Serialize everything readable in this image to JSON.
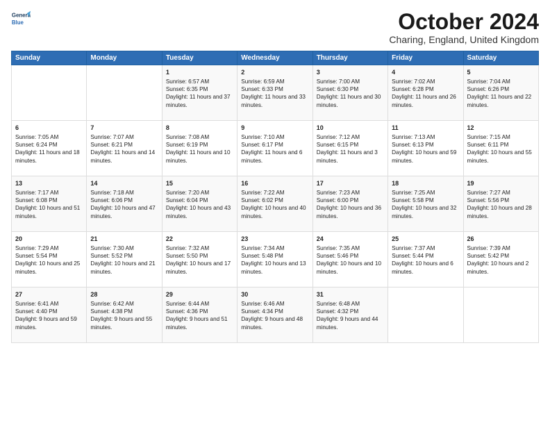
{
  "logo": {
    "line1": "General",
    "line2": "Blue"
  },
  "title": "October 2024",
  "subtitle": "Charing, England, United Kingdom",
  "days_header": [
    "Sunday",
    "Monday",
    "Tuesday",
    "Wednesday",
    "Thursday",
    "Friday",
    "Saturday"
  ],
  "weeks": [
    [
      {
        "day": "",
        "sunrise": "",
        "sunset": "",
        "daylight": ""
      },
      {
        "day": "",
        "sunrise": "",
        "sunset": "",
        "daylight": ""
      },
      {
        "day": "1",
        "sunrise": "Sunrise: 6:57 AM",
        "sunset": "Sunset: 6:35 PM",
        "daylight": "Daylight: 11 hours and 37 minutes."
      },
      {
        "day": "2",
        "sunrise": "Sunrise: 6:59 AM",
        "sunset": "Sunset: 6:33 PM",
        "daylight": "Daylight: 11 hours and 33 minutes."
      },
      {
        "day": "3",
        "sunrise": "Sunrise: 7:00 AM",
        "sunset": "Sunset: 6:30 PM",
        "daylight": "Daylight: 11 hours and 30 minutes."
      },
      {
        "day": "4",
        "sunrise": "Sunrise: 7:02 AM",
        "sunset": "Sunset: 6:28 PM",
        "daylight": "Daylight: 11 hours and 26 minutes."
      },
      {
        "day": "5",
        "sunrise": "Sunrise: 7:04 AM",
        "sunset": "Sunset: 6:26 PM",
        "daylight": "Daylight: 11 hours and 22 minutes."
      }
    ],
    [
      {
        "day": "6",
        "sunrise": "Sunrise: 7:05 AM",
        "sunset": "Sunset: 6:24 PM",
        "daylight": "Daylight: 11 hours and 18 minutes."
      },
      {
        "day": "7",
        "sunrise": "Sunrise: 7:07 AM",
        "sunset": "Sunset: 6:21 PM",
        "daylight": "Daylight: 11 hours and 14 minutes."
      },
      {
        "day": "8",
        "sunrise": "Sunrise: 7:08 AM",
        "sunset": "Sunset: 6:19 PM",
        "daylight": "Daylight: 11 hours and 10 minutes."
      },
      {
        "day": "9",
        "sunrise": "Sunrise: 7:10 AM",
        "sunset": "Sunset: 6:17 PM",
        "daylight": "Daylight: 11 hours and 6 minutes."
      },
      {
        "day": "10",
        "sunrise": "Sunrise: 7:12 AM",
        "sunset": "Sunset: 6:15 PM",
        "daylight": "Daylight: 11 hours and 3 minutes."
      },
      {
        "day": "11",
        "sunrise": "Sunrise: 7:13 AM",
        "sunset": "Sunset: 6:13 PM",
        "daylight": "Daylight: 10 hours and 59 minutes."
      },
      {
        "day": "12",
        "sunrise": "Sunrise: 7:15 AM",
        "sunset": "Sunset: 6:11 PM",
        "daylight": "Daylight: 10 hours and 55 minutes."
      }
    ],
    [
      {
        "day": "13",
        "sunrise": "Sunrise: 7:17 AM",
        "sunset": "Sunset: 6:08 PM",
        "daylight": "Daylight: 10 hours and 51 minutes."
      },
      {
        "day": "14",
        "sunrise": "Sunrise: 7:18 AM",
        "sunset": "Sunset: 6:06 PM",
        "daylight": "Daylight: 10 hours and 47 minutes."
      },
      {
        "day": "15",
        "sunrise": "Sunrise: 7:20 AM",
        "sunset": "Sunset: 6:04 PM",
        "daylight": "Daylight: 10 hours and 43 minutes."
      },
      {
        "day": "16",
        "sunrise": "Sunrise: 7:22 AM",
        "sunset": "Sunset: 6:02 PM",
        "daylight": "Daylight: 10 hours and 40 minutes."
      },
      {
        "day": "17",
        "sunrise": "Sunrise: 7:23 AM",
        "sunset": "Sunset: 6:00 PM",
        "daylight": "Daylight: 10 hours and 36 minutes."
      },
      {
        "day": "18",
        "sunrise": "Sunrise: 7:25 AM",
        "sunset": "Sunset: 5:58 PM",
        "daylight": "Daylight: 10 hours and 32 minutes."
      },
      {
        "day": "19",
        "sunrise": "Sunrise: 7:27 AM",
        "sunset": "Sunset: 5:56 PM",
        "daylight": "Daylight: 10 hours and 28 minutes."
      }
    ],
    [
      {
        "day": "20",
        "sunrise": "Sunrise: 7:29 AM",
        "sunset": "Sunset: 5:54 PM",
        "daylight": "Daylight: 10 hours and 25 minutes."
      },
      {
        "day": "21",
        "sunrise": "Sunrise: 7:30 AM",
        "sunset": "Sunset: 5:52 PM",
        "daylight": "Daylight: 10 hours and 21 minutes."
      },
      {
        "day": "22",
        "sunrise": "Sunrise: 7:32 AM",
        "sunset": "Sunset: 5:50 PM",
        "daylight": "Daylight: 10 hours and 17 minutes."
      },
      {
        "day": "23",
        "sunrise": "Sunrise: 7:34 AM",
        "sunset": "Sunset: 5:48 PM",
        "daylight": "Daylight: 10 hours and 13 minutes."
      },
      {
        "day": "24",
        "sunrise": "Sunrise: 7:35 AM",
        "sunset": "Sunset: 5:46 PM",
        "daylight": "Daylight: 10 hours and 10 minutes."
      },
      {
        "day": "25",
        "sunrise": "Sunrise: 7:37 AM",
        "sunset": "Sunset: 5:44 PM",
        "daylight": "Daylight: 10 hours and 6 minutes."
      },
      {
        "day": "26",
        "sunrise": "Sunrise: 7:39 AM",
        "sunset": "Sunset: 5:42 PM",
        "daylight": "Daylight: 10 hours and 2 minutes."
      }
    ],
    [
      {
        "day": "27",
        "sunrise": "Sunrise: 6:41 AM",
        "sunset": "Sunset: 4:40 PM",
        "daylight": "Daylight: 9 hours and 59 minutes."
      },
      {
        "day": "28",
        "sunrise": "Sunrise: 6:42 AM",
        "sunset": "Sunset: 4:38 PM",
        "daylight": "Daylight: 9 hours and 55 minutes."
      },
      {
        "day": "29",
        "sunrise": "Sunrise: 6:44 AM",
        "sunset": "Sunset: 4:36 PM",
        "daylight": "Daylight: 9 hours and 51 minutes."
      },
      {
        "day": "30",
        "sunrise": "Sunrise: 6:46 AM",
        "sunset": "Sunset: 4:34 PM",
        "daylight": "Daylight: 9 hours and 48 minutes."
      },
      {
        "day": "31",
        "sunrise": "Sunrise: 6:48 AM",
        "sunset": "Sunset: 4:32 PM",
        "daylight": "Daylight: 9 hours and 44 minutes."
      },
      {
        "day": "",
        "sunrise": "",
        "sunset": "",
        "daylight": ""
      },
      {
        "day": "",
        "sunrise": "",
        "sunset": "",
        "daylight": ""
      }
    ]
  ]
}
